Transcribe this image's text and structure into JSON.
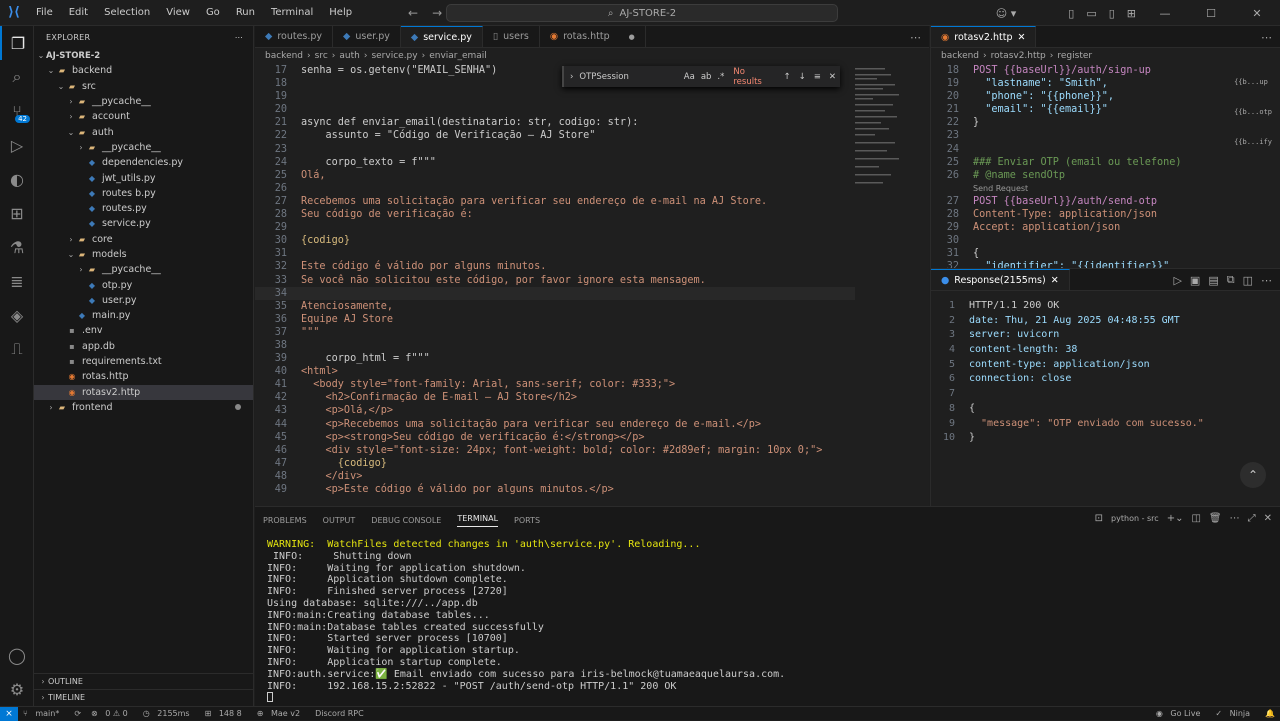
{
  "menu": [
    "File",
    "Edit",
    "Selection",
    "View",
    "Go",
    "Run",
    "Terminal",
    "Help"
  ],
  "search_label": "AJ-STORE-2",
  "explorer": {
    "title": "EXPLORER",
    "root": "AJ-STORE-2",
    "items": [
      {
        "label": "backend",
        "indent": 1,
        "type": "folder",
        "open": true
      },
      {
        "label": "src",
        "indent": 2,
        "type": "folder",
        "open": true
      },
      {
        "label": "__pycache__",
        "indent": 3,
        "type": "folder",
        "open": false
      },
      {
        "label": "account",
        "indent": 3,
        "type": "folder",
        "open": false
      },
      {
        "label": "auth",
        "indent": 3,
        "type": "folder",
        "open": true
      },
      {
        "label": "__pycache__",
        "indent": 4,
        "type": "folder",
        "open": false
      },
      {
        "label": "dependencies.py",
        "indent": 4,
        "type": "py"
      },
      {
        "label": "jwt_utils.py",
        "indent": 4,
        "type": "py"
      },
      {
        "label": "routes b.py",
        "indent": 4,
        "type": "py"
      },
      {
        "label": "routes.py",
        "indent": 4,
        "type": "py"
      },
      {
        "label": "service.py",
        "indent": 4,
        "type": "py"
      },
      {
        "label": "core",
        "indent": 3,
        "type": "folder",
        "open": false
      },
      {
        "label": "models",
        "indent": 3,
        "type": "folder",
        "open": true
      },
      {
        "label": "__pycache__",
        "indent": 4,
        "type": "folder",
        "open": false
      },
      {
        "label": "otp.py",
        "indent": 4,
        "type": "py"
      },
      {
        "label": "user.py",
        "indent": 4,
        "type": "py"
      },
      {
        "label": "main.py",
        "indent": 3,
        "type": "py"
      },
      {
        "label": ".env",
        "indent": 2,
        "type": "plain"
      },
      {
        "label": "app.db",
        "indent": 2,
        "type": "plain"
      },
      {
        "label": "requirements.txt",
        "indent": 2,
        "type": "plain"
      },
      {
        "label": "rotas.http",
        "indent": 2,
        "type": "http"
      },
      {
        "label": "rotasv2.http",
        "indent": 2,
        "type": "http",
        "selected": true
      },
      {
        "label": "frontend",
        "indent": 1,
        "type": "folder",
        "open": false,
        "dot": true
      }
    ],
    "outline": "OUTLINE",
    "timeline": "TIMELINE"
  },
  "editor1": {
    "tabs": [
      "routes.py",
      "user.py",
      "service.py",
      "users",
      "rotas.http"
    ],
    "active_tab": 2,
    "breadcrumb": [
      "backend",
      "src",
      "auth",
      "service.py",
      "enviar_email"
    ],
    "find": {
      "query": "OTPSession",
      "result": "No results"
    },
    "lines": [
      {
        "n": "17",
        "t": "senha = os.getenv(\"EMAIL_SENHA\")"
      },
      {
        "n": "18",
        "t": ""
      },
      {
        "n": "19",
        "t": ""
      },
      {
        "n": "20",
        "t": ""
      },
      {
        "n": "21",
        "t": "async def enviar_email(destinatario: str, codigo: str):"
      },
      {
        "n": "22",
        "t": "    assunto = \"Código de Verificação – AJ Store\""
      },
      {
        "n": "23",
        "t": ""
      },
      {
        "n": "24",
        "t": "    corpo_texto = f\"\"\""
      },
      {
        "n": "25",
        "t": "Olá,"
      },
      {
        "n": "26",
        "t": ""
      },
      {
        "n": "27",
        "t": "Recebemos uma solicitação para verificar seu endereço de e-mail na AJ Store."
      },
      {
        "n": "28",
        "t": "Seu código de verificação é:"
      },
      {
        "n": "29",
        "t": ""
      },
      {
        "n": "30",
        "t": "{codigo}"
      },
      {
        "n": "31",
        "t": ""
      },
      {
        "n": "32",
        "t": "Este código é válido por alguns minutos."
      },
      {
        "n": "33",
        "t": "Se você não solicitou este código, por favor ignore esta mensagem."
      },
      {
        "n": "34",
        "t": ""
      },
      {
        "n": "35",
        "t": "Atenciosamente,"
      },
      {
        "n": "36",
        "t": "Equipe AJ Store"
      },
      {
        "n": "37",
        "t": "\"\"\""
      },
      {
        "n": "38",
        "t": ""
      },
      {
        "n": "39",
        "t": "    corpo_html = f\"\"\""
      },
      {
        "n": "40",
        "t": "<html>"
      },
      {
        "n": "41",
        "t": "  <body style=\"font-family: Arial, sans-serif; color: #333;\">"
      },
      {
        "n": "42",
        "t": "    <h2>Confirmação de E-mail – AJ Store</h2>"
      },
      {
        "n": "43",
        "t": "    <p>Olá,</p>"
      },
      {
        "n": "44",
        "t": "    <p>Recebemos uma solicitação para verificar seu endereço de e-mail.</p>"
      },
      {
        "n": "45",
        "t": "    <p><strong>Seu código de verificação é:</strong></p>"
      },
      {
        "n": "46",
        "t": "    <div style=\"font-size: 24px; font-weight: bold; color: #2d89ef; margin: 10px 0;\">"
      },
      {
        "n": "47",
        "t": "      {codigo}"
      },
      {
        "n": "48",
        "t": "    </div>"
      },
      {
        "n": "49",
        "t": "    <p>Este código é válido por alguns minutos.</p>"
      }
    ]
  },
  "editor2": {
    "tab": "rotasv2.http",
    "breadcrumb": [
      "backend",
      "rotasv2.http",
      "register"
    ],
    "lines": [
      {
        "n": "18",
        "t": "POST {{baseUrl}}/auth/sign-up"
      },
      {
        "n": "19",
        "t": "  \"lastname\": \"Smith\","
      },
      {
        "n": "20",
        "t": "  \"phone\": \"{{phone}}\","
      },
      {
        "n": "21",
        "t": "  \"email\": \"{{email}}\""
      },
      {
        "n": "22",
        "t": "}"
      },
      {
        "n": "23",
        "t": ""
      },
      {
        "n": "24",
        "t": ""
      },
      {
        "n": "25",
        "t": "### Enviar OTP (email ou telefone)"
      },
      {
        "n": "26",
        "t": "# @name sendOtp"
      },
      {
        "n": "",
        "t": "Send Request"
      },
      {
        "n": "27",
        "t": "POST {{baseUrl}}/auth/send-otp"
      },
      {
        "n": "28",
        "t": "Content-Type: application/json"
      },
      {
        "n": "29",
        "t": "Accept: application/json"
      },
      {
        "n": "30",
        "t": ""
      },
      {
        "n": "31",
        "t": "{"
      },
      {
        "n": "32",
        "t": "  \"identifier\": \"{{identifier}}\""
      }
    ],
    "hints": [
      "{{b...up",
      "{{b...otp",
      "{{b...ify"
    ]
  },
  "response": {
    "tab": "Response(2155ms)",
    "lines": [
      {
        "n": "1",
        "t": "HTTP/1.1 200 OK"
      },
      {
        "n": "2",
        "t": "date: Thu, 21 Aug 2025 04:48:55 GMT"
      },
      {
        "n": "3",
        "t": "server: uvicorn"
      },
      {
        "n": "4",
        "t": "content-length: 38"
      },
      {
        "n": "5",
        "t": "content-type: application/json"
      },
      {
        "n": "6",
        "t": "connection: close"
      },
      {
        "n": "7",
        "t": ""
      },
      {
        "n": "8",
        "t": "{"
      },
      {
        "n": "9",
        "t": "  \"message\": \"OTP enviado com sucesso.\""
      },
      {
        "n": "10",
        "t": "}"
      }
    ]
  },
  "panel": {
    "tabs": [
      "PROBLEMS",
      "OUTPUT",
      "DEBUG CONSOLE",
      "TERMINAL",
      "PORTS"
    ],
    "active_tab": 3,
    "terminal_name": "python - src",
    "lines": [
      "WARNING:  WatchFiles detected changes in 'auth\\service.py'. Reloading...",
      " INFO:     Shutting down",
      "INFO:     Waiting for application shutdown.",
      "INFO:     Application shutdown complete.",
      "INFO:     Finished server process [2720]",
      "Using database: sqlite:///../app.db",
      "INFO:main:Creating database tables...",
      "INFO:main:Database tables created successfully",
      "INFO:     Started server process [10700]",
      "INFO:     Waiting for application startup.",
      "INFO:     Application startup complete.",
      "INFO:auth.service:✅ Email enviado com sucesso para iris-belmock@tuamaeaquelaursa.com.",
      "INFO:     192.168.15.2:52822 - \"POST /auth/send-otp HTTP/1.1\" 200 OK"
    ]
  },
  "status": {
    "branch": "main*",
    "problems": "0 ⚠ 0",
    "timing": "2155ms",
    "tabs": "148 8",
    "mae": "Mae v2",
    "discord": "Discord RPC",
    "golive": "Go Live",
    "ninja": "Ninja"
  }
}
